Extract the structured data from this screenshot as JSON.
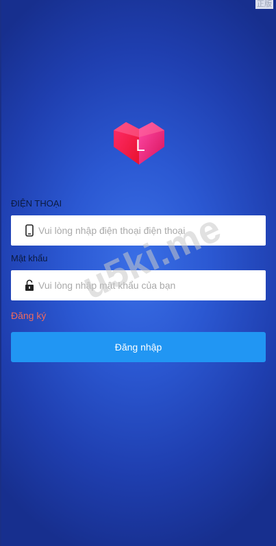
{
  "corner_tag": "正版",
  "logo": {
    "letter": "L",
    "icon": "heart-bag-icon"
  },
  "phone": {
    "label": "ĐIỆN THOẠI",
    "placeholder": "Vui lòng nhập điện thoại điện thoại",
    "value": "",
    "icon": "phone-icon"
  },
  "password": {
    "label": "Mật khẩu",
    "placeholder": "Vui lòng nhập mật khẩu của bạn",
    "value": "",
    "icon": "lock-icon"
  },
  "register_link": "Đăng ký",
  "login_button": "Đăng nhập",
  "watermark": "u5ki.me",
  "colors": {
    "background": "#2b58d2",
    "button": "#2196f3",
    "register_link": "#f06a5d"
  }
}
